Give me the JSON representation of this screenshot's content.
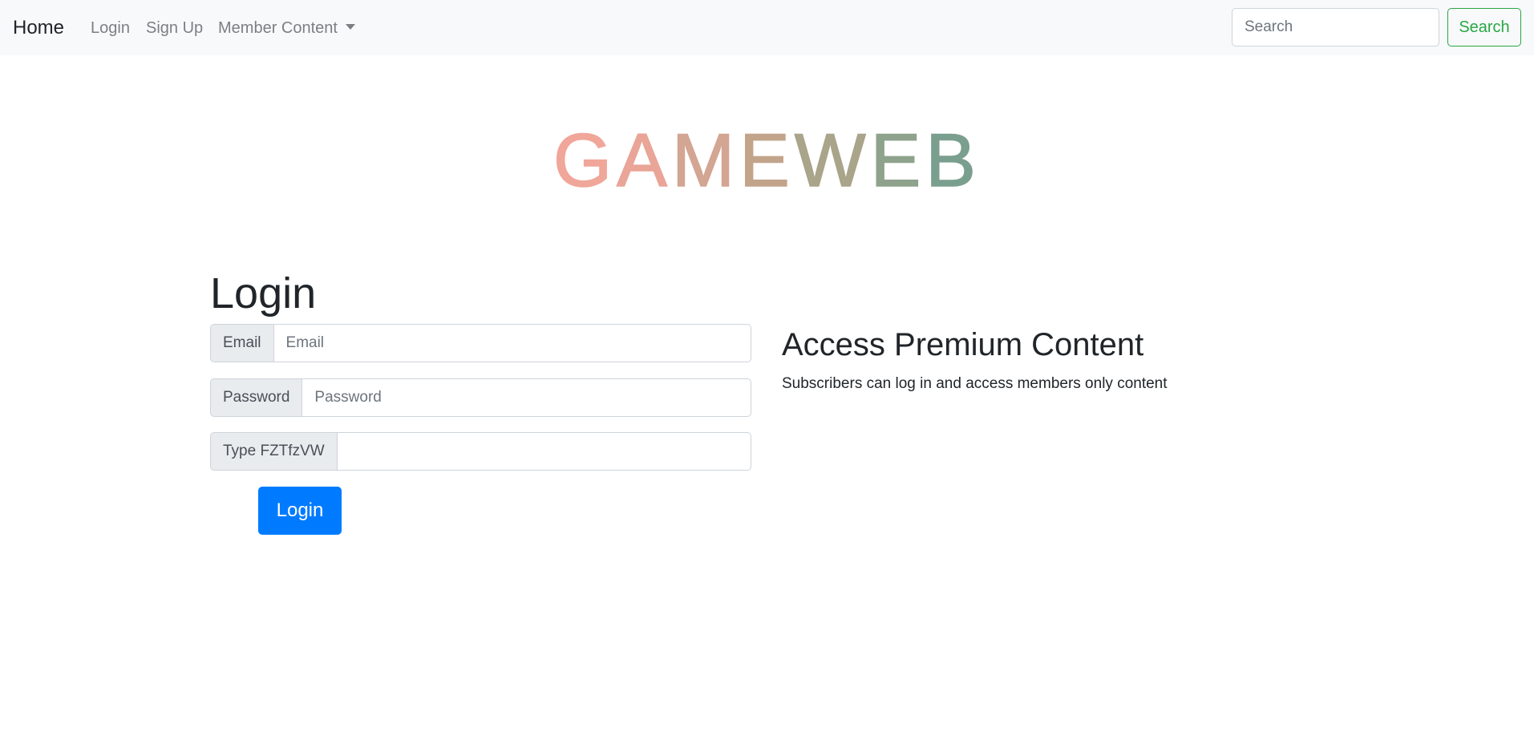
{
  "navbar": {
    "brand": "Home",
    "links": {
      "login": "Login",
      "signup": "Sign Up",
      "member_content": "Member Content"
    },
    "search": {
      "placeholder": "Search",
      "button_label": "Search"
    }
  },
  "logo": {
    "text": "GAMEWEB",
    "letters": [
      "G",
      "A",
      "M",
      "E",
      "W",
      "E",
      "B"
    ],
    "letter_colors": [
      "#f0a699",
      "#e9a597",
      "#d3a593",
      "#c2a48b",
      "#a9a48a",
      "#8ea28c",
      "#7b9f8f"
    ]
  },
  "login": {
    "title": "Login",
    "email": {
      "addon": "Email",
      "placeholder": "Email",
      "value": ""
    },
    "password": {
      "addon": "Password",
      "placeholder": "Password",
      "value": ""
    },
    "captcha": {
      "addon": "Type FZTfzVW",
      "value": ""
    },
    "submit_label": "Login"
  },
  "premium": {
    "title": "Access Premium Content",
    "text": "Subscribers can log in and access members only content"
  },
  "colors": {
    "navbar_bg": "#f8f9fa",
    "primary": "#007bff",
    "success": "#28a745",
    "addon_bg": "#e9ecef"
  }
}
